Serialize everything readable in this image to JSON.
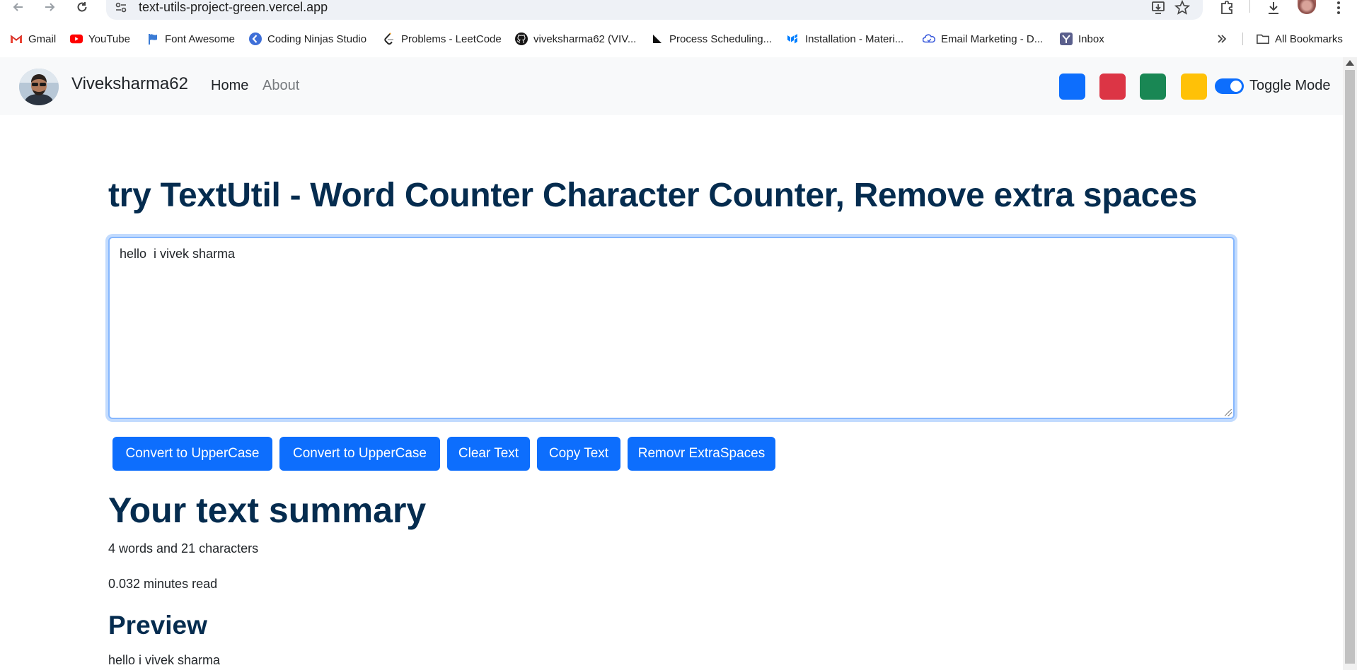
{
  "browser": {
    "url": "text-utils-project-green.vercel.app",
    "bookmarks": [
      {
        "label": "Gmail",
        "icon": "gmail-icon"
      },
      {
        "label": "YouTube",
        "icon": "youtube-icon"
      },
      {
        "label": "Font Awesome",
        "icon": "font-awesome-icon"
      },
      {
        "label": "Coding Ninjas Studio",
        "icon": "coding-ninjas-icon"
      },
      {
        "label": "Problems - LeetCode",
        "icon": "leetcode-icon"
      },
      {
        "label": "viveksharma62 (VIV...",
        "icon": "github-icon"
      },
      {
        "label": "Process Scheduling...",
        "icon": "process-icon"
      },
      {
        "label": "Installation - Materi...",
        "icon": "mui-icon"
      },
      {
        "label": "Email Marketing - D...",
        "icon": "email-marketing-icon"
      },
      {
        "label": "Inbox",
        "icon": "inbox-icon"
      }
    ],
    "all_bookmarks": "All Bookmarks"
  },
  "navbar": {
    "brand": "Viveksharma62",
    "links": [
      "Home",
      "About"
    ],
    "swatches": [
      "#0d6efd",
      "#dc3545",
      "#198754",
      "#ffc107"
    ],
    "toggle_label": "Toggle Mode"
  },
  "main": {
    "heading": "try TextUtil - Word Counter Character Counter, Remove extra spaces",
    "textarea_value": "hello  i vivek sharma",
    "buttons": [
      "Convert to UpperCase",
      "Convert to UpperCase",
      "Clear Text",
      "Copy Text",
      "Removr ExtraSpaces"
    ],
    "summary_title": "Your text summary",
    "word_char_count": "4 words and 21 characters",
    "read_time": "0.032 minutes read",
    "preview_title": "Preview",
    "preview_text": "hello i vivek sharma"
  }
}
